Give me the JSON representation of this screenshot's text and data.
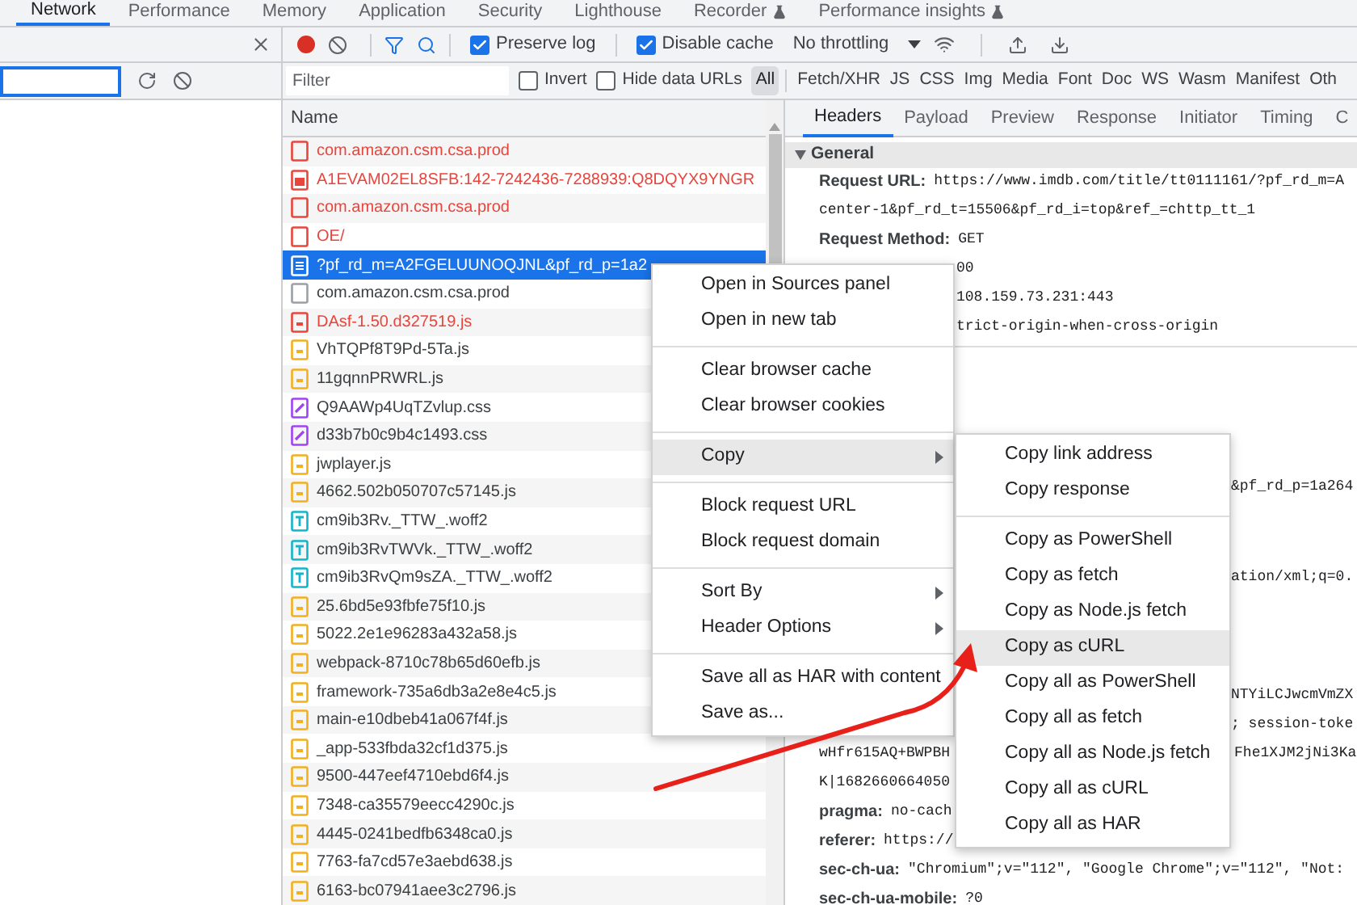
{
  "devtools_tabs": [
    {
      "label": "Network",
      "selected": true,
      "experimental": false
    },
    {
      "label": "Performance",
      "selected": false,
      "experimental": false
    },
    {
      "label": "Memory",
      "selected": false,
      "experimental": false
    },
    {
      "label": "Application",
      "selected": false,
      "experimental": false
    },
    {
      "label": "Security",
      "selected": false,
      "experimental": false
    },
    {
      "label": "Lighthouse",
      "selected": false,
      "experimental": false
    },
    {
      "label": "Recorder",
      "selected": false,
      "experimental": true
    },
    {
      "label": "Performance insights",
      "selected": false,
      "experimental": true
    }
  ],
  "toolbar": {
    "recording": true,
    "preserve_log": {
      "label": "Preserve log",
      "checked": true
    },
    "disable_cache": {
      "label": "Disable cache",
      "checked": true
    },
    "throttling": "No throttling"
  },
  "filter": {
    "placeholder": "Filter",
    "invert": {
      "label": "Invert",
      "checked": false
    },
    "hide_data_urls": {
      "label": "Hide data URLs",
      "checked": false
    },
    "types": [
      {
        "label": "All",
        "selected": true
      },
      {
        "label": "Fetch/XHR",
        "selected": false
      },
      {
        "label": "JS",
        "selected": false
      },
      {
        "label": "CSS",
        "selected": false
      },
      {
        "label": "Img",
        "selected": false
      },
      {
        "label": "Media",
        "selected": false
      },
      {
        "label": "Font",
        "selected": false
      },
      {
        "label": "Doc",
        "selected": false
      },
      {
        "label": "WS",
        "selected": false
      },
      {
        "label": "Wasm",
        "selected": false
      },
      {
        "label": "Manifest",
        "selected": false
      },
      {
        "label": "Oth",
        "selected": false
      }
    ]
  },
  "requests": {
    "column": "Name",
    "rows": [
      {
        "name": "com.amazon.csm.csa.prod",
        "kind": "other",
        "failed": true,
        "selected": false
      },
      {
        "name": "A1EVAM02EL8SFB:142-7242436-7288939:Q8DQYX9YNGR",
        "kind": "image",
        "failed": true,
        "selected": false
      },
      {
        "name": "com.amazon.csm.csa.prod",
        "kind": "other",
        "failed": true,
        "selected": false
      },
      {
        "name": "OE/",
        "kind": "other",
        "failed": true,
        "selected": false
      },
      {
        "name": "?pf_rd_m=A2FGELUUNOQJNL&pf_rd_p=1a2",
        "kind": "document",
        "failed": false,
        "selected": true
      },
      {
        "name": "com.amazon.csm.csa.prod",
        "kind": "other",
        "failed": false,
        "selected": false
      },
      {
        "name": "DAsf-1.50.d327519.js",
        "kind": "script",
        "failed": true,
        "selected": false
      },
      {
        "name": "VhTQPf8T9Pd-5Ta.js",
        "kind": "script",
        "failed": false,
        "selected": false
      },
      {
        "name": "11gqnnPRWRL.js",
        "kind": "script",
        "failed": false,
        "selected": false
      },
      {
        "name": "Q9AAWp4UqTZvlup.css",
        "kind": "stylesheet",
        "failed": false,
        "selected": false
      },
      {
        "name": "d33b7b0c9b4c1493.css",
        "kind": "stylesheet",
        "failed": false,
        "selected": false
      },
      {
        "name": "jwplayer.js",
        "kind": "script",
        "failed": false,
        "selected": false
      },
      {
        "name": "4662.502b050707c57145.js",
        "kind": "script",
        "failed": false,
        "selected": false
      },
      {
        "name": "cm9ib3Rv._TTW_.woff2",
        "kind": "font",
        "failed": false,
        "selected": false
      },
      {
        "name": "cm9ib3RvTWVk._TTW_.woff2",
        "kind": "font",
        "failed": false,
        "selected": false
      },
      {
        "name": "cm9ib3RvQm9sZA._TTW_.woff2",
        "kind": "font",
        "failed": false,
        "selected": false
      },
      {
        "name": "25.6bd5e93fbfe75f10.js",
        "kind": "script",
        "failed": false,
        "selected": false
      },
      {
        "name": "5022.2e1e96283a432a58.js",
        "kind": "script",
        "failed": false,
        "selected": false
      },
      {
        "name": "webpack-8710c78b65d60efb.js",
        "kind": "script",
        "failed": false,
        "selected": false
      },
      {
        "name": "framework-735a6db3a2e8e4c5.js",
        "kind": "script",
        "failed": false,
        "selected": false
      },
      {
        "name": "main-e10dbeb41a067f4f.js",
        "kind": "script",
        "failed": false,
        "selected": false
      },
      {
        "name": "_app-533fbda32cf1d375.js",
        "kind": "script",
        "failed": false,
        "selected": false
      },
      {
        "name": "9500-447eef4710ebd6f4.js",
        "kind": "script",
        "failed": false,
        "selected": false
      },
      {
        "name": "7348-ca35579eecc4290c.js",
        "kind": "script",
        "failed": false,
        "selected": false
      },
      {
        "name": "4445-0241bedfb6348ca0.js",
        "kind": "script",
        "failed": false,
        "selected": false
      },
      {
        "name": "7763-fa7cd57e3aebd638.js",
        "kind": "script",
        "failed": false,
        "selected": false
      },
      {
        "name": "6163-bc07941aee3c2796.js",
        "kind": "script",
        "failed": false,
        "selected": false
      }
    ]
  },
  "details": {
    "tabs": [
      {
        "label": "Headers",
        "selected": true
      },
      {
        "label": "Payload",
        "selected": false
      },
      {
        "label": "Preview",
        "selected": false
      },
      {
        "label": "Response",
        "selected": false
      },
      {
        "label": "Initiator",
        "selected": false
      },
      {
        "label": "Timing",
        "selected": false
      },
      {
        "label": "C",
        "selected": false
      }
    ],
    "section": {
      "title": "General",
      "expanded": true
    },
    "general_rows": [
      {
        "kind": "full",
        "label": "Request URL:",
        "value": "https://www.imdb.com/title/tt0111161/?pf_rd_m=A"
      },
      {
        "kind": "full",
        "value": "center-1&pf_rd_t=15506&pf_rd_i=top&ref_=chttp_tt_1"
      },
      {
        "kind": "full",
        "label": "Request Method:",
        "value": "GET"
      },
      {
        "kind": "after_menu",
        "value": "00"
      },
      {
        "kind": "after_menu",
        "value": "108.159.73.231:443"
      },
      {
        "kind": "after_menu",
        "value": "trict-origin-when-cross-origin"
      }
    ],
    "header_fragments": [
      [
        {
          "kind": "after_submenu",
          "value": "&pf_rd_p=1a264"
        }
      ],
      [
        {
          "kind": "after_submenu",
          "value": "ation/xml;q=0."
        }
      ],
      [
        {
          "kind": "after_submenu",
          "value": "NTYiLCJwcmVmZX"
        },
        {
          "kind": "after_submenu",
          "value": "; session-toke"
        },
        {
          "kind": "split",
          "value": "wHfr615AQ+BWPBH",
          "value_right": "Fhe1XJM2jNi3Ka"
        },
        {
          "kind": "full",
          "value": "K|1682660664050"
        },
        {
          "kind": "full",
          "label": "pragma:",
          "value": "no-cach"
        },
        {
          "kind": "full",
          "label": "referer:",
          "value": "https://"
        },
        {
          "kind": "full",
          "label": "sec-ch-ua:",
          "value": "\"Chromium\";v=\"112\", \"Google Chrome\";v=\"112\", \"Not:"
        },
        {
          "kind": "full",
          "label": "sec-ch-ua-mobile:",
          "value": "?0"
        }
      ]
    ]
  },
  "context_menu": {
    "groups": [
      [
        {
          "label": "Open in Sources panel",
          "has_submenu": false,
          "highlighted": false
        },
        {
          "label": "Open in new tab",
          "has_submenu": false,
          "highlighted": false
        }
      ],
      [
        {
          "label": "Clear browser cache",
          "has_submenu": false,
          "highlighted": false
        },
        {
          "label": "Clear browser cookies",
          "has_submenu": false,
          "highlighted": false
        }
      ],
      [
        {
          "label": "Copy",
          "has_submenu": true,
          "highlighted": true
        }
      ],
      [
        {
          "label": "Block request URL",
          "has_submenu": false,
          "highlighted": false
        },
        {
          "label": "Block request domain",
          "has_submenu": false,
          "highlighted": false
        }
      ],
      [
        {
          "label": "Sort By",
          "has_submenu": true,
          "highlighted": false
        },
        {
          "label": "Header Options",
          "has_submenu": true,
          "highlighted": false
        }
      ],
      [
        {
          "label": "Save all as HAR with content",
          "has_submenu": false,
          "highlighted": false
        },
        {
          "label": "Save as...",
          "has_submenu": false,
          "highlighted": false
        }
      ]
    ]
  },
  "copy_submenu": {
    "groups": [
      [
        {
          "label": "Copy link address",
          "has_submenu": false,
          "highlighted": false
        },
        {
          "label": "Copy response",
          "has_submenu": false,
          "highlighted": false
        }
      ],
      [
        {
          "label": "Copy as PowerShell",
          "has_submenu": false,
          "highlighted": false
        },
        {
          "label": "Copy as fetch",
          "has_submenu": false,
          "highlighted": false
        },
        {
          "label": "Copy as Node.js fetch",
          "has_submenu": false,
          "highlighted": false
        },
        {
          "label": "Copy as cURL",
          "has_submenu": false,
          "highlighted": true
        },
        {
          "label": "Copy all as PowerShell",
          "has_submenu": false,
          "highlighted": false
        },
        {
          "label": "Copy all as fetch",
          "has_submenu": false,
          "highlighted": false
        },
        {
          "label": "Copy all as Node.js fetch",
          "has_submenu": false,
          "highlighted": false
        },
        {
          "label": "Copy all as cURL",
          "has_submenu": false,
          "highlighted": false
        },
        {
          "label": "Copy all as HAR",
          "has_submenu": false,
          "highlighted": false
        }
      ]
    ]
  }
}
